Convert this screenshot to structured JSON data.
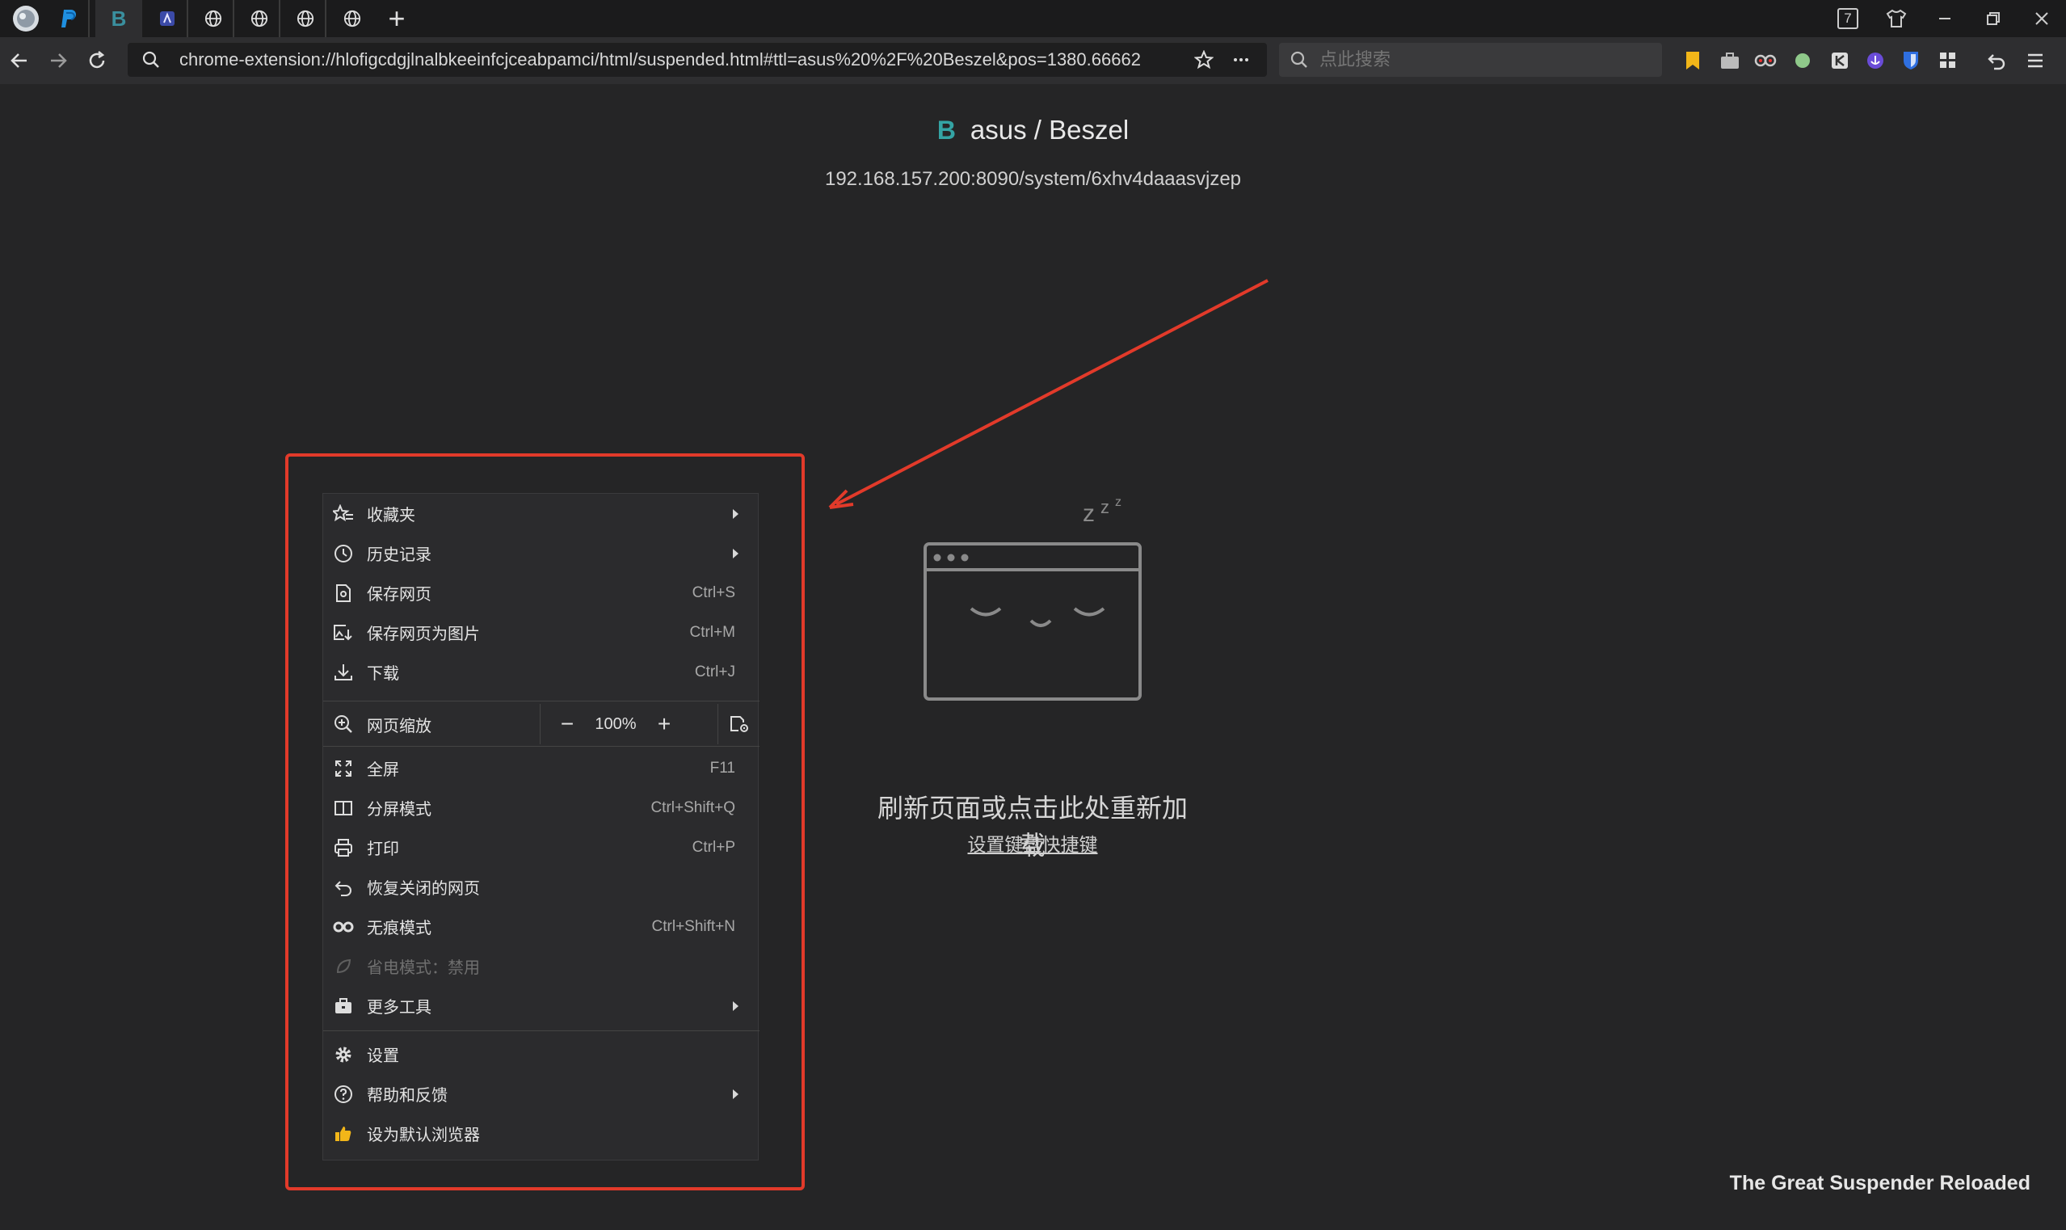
{
  "tabs": [
    {
      "name": "profile-avatar"
    },
    {
      "name": "tab-paypal"
    },
    {
      "name": "tab-beszel",
      "active": true,
      "fav_text": "B"
    },
    {
      "name": "tab-app"
    },
    {
      "name": "tab-globe-1"
    },
    {
      "name": "tab-globe-2"
    },
    {
      "name": "tab-globe-3"
    },
    {
      "name": "tab-globe-4"
    }
  ],
  "window": {
    "tab_count": "7"
  },
  "address": {
    "url": "chrome-extension://hlofigcdgjlnalbkeeinfcjceabpamci/html/suspended.html#ttl=asus%20%2F%20Beszel&pos=1380.66662"
  },
  "search": {
    "placeholder": "点此搜索"
  },
  "page": {
    "logo": "B",
    "title": "asus / Beszel",
    "url": "192.168.157.200:8090/system/6xhv4daaasvjzep",
    "reload_text": "刷新页面或点击此处重新加载",
    "shortcut_link": "设置键盘快捷键",
    "brand": "The Great Suspender Reloaded"
  },
  "menu": {
    "favorites": "收藏夹",
    "history": "历史记录",
    "save_page": "保存网页",
    "save_page_short": "Ctrl+S",
    "save_as_image": "保存网页为图片",
    "save_as_image_short": "Ctrl+M",
    "download": "下载",
    "download_short": "Ctrl+J",
    "zoom": "网页缩放",
    "zoom_value": "100%",
    "fullscreen": "全屏",
    "fullscreen_short": "F11",
    "split": "分屏模式",
    "split_short": "Ctrl+Shift+Q",
    "print": "打印",
    "print_short": "Ctrl+P",
    "restore": "恢复关闭的网页",
    "incognito": "无痕模式",
    "incognito_short": "Ctrl+Shift+N",
    "power_saving": "省电模式：禁用",
    "more_tools": "更多工具",
    "settings": "设置",
    "help": "帮助和反馈",
    "default_browser": "设为默认浏览器"
  },
  "colors": {
    "annotation": "#e23a2a",
    "beszel_logo": "#34a4a4",
    "background": "#252526"
  }
}
